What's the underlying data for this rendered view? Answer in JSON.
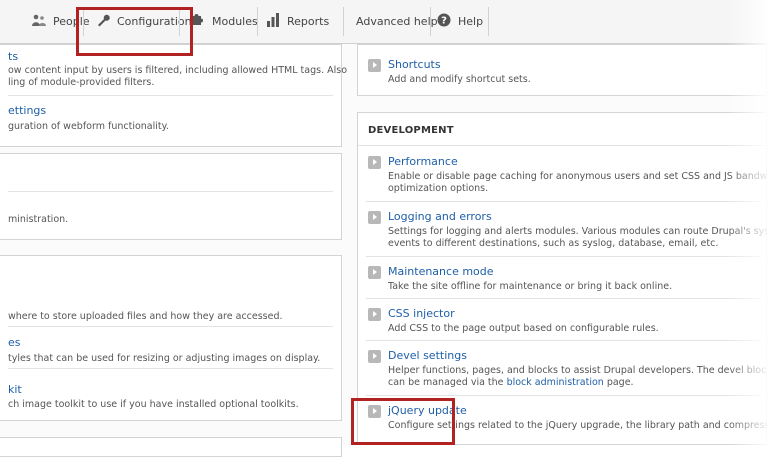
{
  "toolbar": {
    "people": "People",
    "configuration": "Configuration",
    "modules": "Modules",
    "reports": "Reports",
    "advanced_help": "Advanced help",
    "help": "Help"
  },
  "left_column": {
    "p1_item1_link": "ts",
    "p1_item1_desc1": "ow content input by users is filtered, including allowed HTML tags. Also",
    "p1_item1_desc2": "ling of module-provided filters.",
    "p1_item2_link": "ettings",
    "p1_item2_desc": "guration of webform functionality.",
    "p2_desc": "ministration.",
    "p3_item1_link": "",
    "p3_item1_desc": "where to store uploaded files and how they are accessed.",
    "p3_item2_link": "es",
    "p3_item2_desc": "tyles that can be used for resizing or adjusting images on display.",
    "p3_item3_link": "kit",
    "p3_item3_desc": "ch image toolkit to use if you have installed optional toolkits."
  },
  "right_column": {
    "shortcuts_link": "Shortcuts",
    "shortcuts_desc": "Add and modify shortcut sets.",
    "development_title": "DEVELOPMENT",
    "performance_link": "Performance",
    "performance_desc1": "Enable or disable page caching for anonymous users and set CSS and JS bandwidth",
    "performance_desc2": "optimization options.",
    "logging_link": "Logging and errors",
    "logging_desc1": "Settings for logging and alerts modules. Various modules can route Drupal's system",
    "logging_desc2": "events to different destinations, such as syslog, database, email, etc.",
    "maintenance_link": "Maintenance mode",
    "maintenance_desc": "Take the site offline for maintenance or bring it back online.",
    "css_link": "CSS injector",
    "css_desc": "Add CSS to the page output based on configurable rules.",
    "devel_link": "Devel settings",
    "devel_desc1": "Helper functions, pages, and blocks to assist Drupal developers. The devel blocks",
    "devel_desc2_pre": "can be managed via the",
    "devel_desc2_link": "block administration",
    "devel_desc2_post": "page.",
    "jquery_link": "jQuery update",
    "jquery_desc": "Configure settings related to the jQuery upgrade, the library path and compression."
  },
  "colors": {
    "link": "#1e5fa8",
    "highlight": "#b22222"
  }
}
